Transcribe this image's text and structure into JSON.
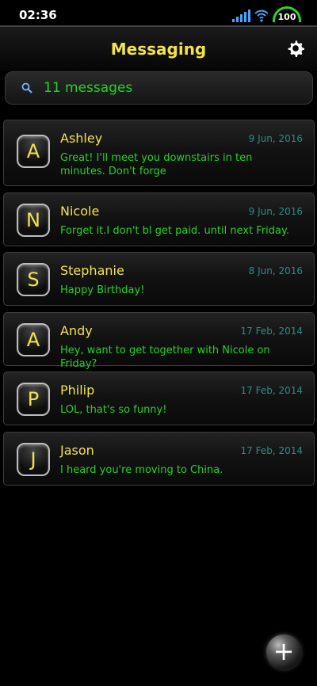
{
  "status_bar": {
    "time": "02:36",
    "battery": "100"
  },
  "header": {
    "title": "Messaging"
  },
  "search": {
    "label": "11 messages"
  },
  "conversations": [
    {
      "initial": "A",
      "name": "Ashley",
      "date": "9 Jun, 2016",
      "message": "Great! I'll meet you downstairs in ten minutes. Don't forge"
    },
    {
      "initial": "N",
      "name": "Nicole",
      "date": "9 Jun, 2016",
      "message": "Forget it.I don't bl get paid. until next Friday."
    },
    {
      "initial": "S",
      "name": "Stephanie",
      "date": "8 Jun, 2016",
      "message": "Happy Birthday!"
    },
    {
      "initial": "A",
      "name": "Andy",
      "date": "17 Feb, 2014",
      "message": "Hey, want to get together with Nicole on Friday?"
    },
    {
      "initial": "P",
      "name": "Philip",
      "date": "17 Feb, 2014",
      "message": "LOL, that's so funny!"
    },
    {
      "initial": "J",
      "name": "Jason",
      "date": "17 Feb, 2014",
      "message": "I heard you're moving to China."
    }
  ],
  "colors": {
    "accent_yellow": "#f3e34a",
    "message_green": "#24d324",
    "date_teal": "#2f8a8a"
  }
}
